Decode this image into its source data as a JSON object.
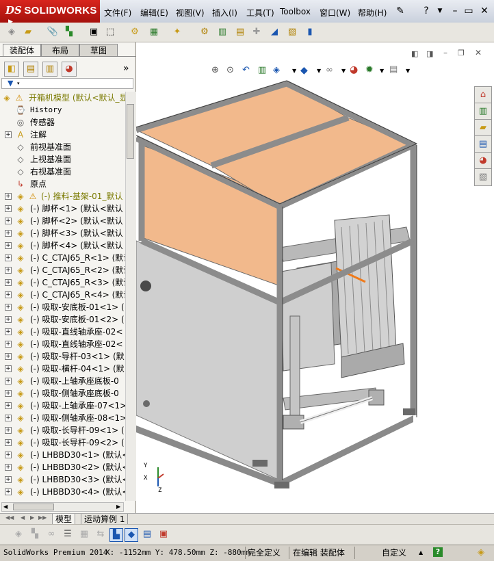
{
  "app": {
    "logo_ds": "DS",
    "logo_name": "SOLIDWORKS"
  },
  "menu": [
    "文件(F)",
    "编辑(E)",
    "视图(V)",
    "插入(I)",
    "工具(T)",
    "Toolbox",
    "窗口(W)",
    "帮助(H)"
  ],
  "left_tabs": [
    "装配体",
    "布局",
    "草图"
  ],
  "tree": {
    "root": "开箱机模型  (默认<默认_显",
    "items": [
      {
        "label": "History",
        "mono": true
      },
      {
        "label": "传感器"
      },
      {
        "label": "注解",
        "expand": true
      },
      {
        "label": "前视基准面"
      },
      {
        "label": "上视基准面"
      },
      {
        "label": "右视基准面"
      },
      {
        "label": "原点"
      }
    ],
    "components": [
      {
        "label": "(-) 推料-基架-01_默认",
        "warn": true,
        "color": "#7a7a00"
      },
      {
        "label": "(-) 脚杯<1> (默认<默认"
      },
      {
        "label": "(-) 脚杯<2> (默认<默认"
      },
      {
        "label": "(-) 脚杯<3> (默认<默认"
      },
      {
        "label": "(-) 脚杯<4> (默认<默认"
      },
      {
        "label": "(-) C_CTAJ65_R<1> (默认"
      },
      {
        "label": "(-) C_CTAJ65_R<2> (默认"
      },
      {
        "label": "(-) C_CTAJ65_R<3> (默认"
      },
      {
        "label": "(-) C_CTAJ65_R<4> (默认"
      },
      {
        "label": "(-) 吸取-安底板-01<1> ("
      },
      {
        "label": "(-) 吸取-安底板-01<2> ("
      },
      {
        "label": "(-) 吸取-直线轴承座-02<"
      },
      {
        "label": "(-) 吸取-直线轴承座-02<"
      },
      {
        "label": "(-) 吸取-导杆-03<1> (默"
      },
      {
        "label": "(-) 吸取-横杆-04<1> (默"
      },
      {
        "label": "(-) 吸取-上轴承座底板-0"
      },
      {
        "label": "(-) 吸取-侧轴承座底板-0"
      },
      {
        "label": "(-) 吸取-上轴承座-07<1>"
      },
      {
        "label": "(-) 吸取-侧轴承座-08<1>"
      },
      {
        "label": "(-) 吸取-长导杆-09<1> ("
      },
      {
        "label": "(-) 吸取-长导杆-09<2> ("
      },
      {
        "label": "(-) LHBBD30<1> (默认<默"
      },
      {
        "label": "(-) LHBBD30<2> (默认<默"
      },
      {
        "label": "(-) LHBBD30<3> (默认<默"
      },
      {
        "label": "(-) LHBBD30<4> (默认<默"
      }
    ]
  },
  "bottom_tabs": [
    "模型",
    "运动算例 1"
  ],
  "triad": {
    "x": "X",
    "y": "Y",
    "z": "Z"
  },
  "status": {
    "product": "SolidWorks Premium 2014",
    "coords": "X: -1152mm Y: 478.50mm Z: -880mm",
    "constraint": "完全定义",
    "mode": "在编辑 装配体",
    "custom": "自定义"
  },
  "colors": {
    "brand": "#c8161d",
    "panel_orange": "#f2b98c",
    "frame_gray": "#9c9c9c",
    "sheet": "#cfcfcf"
  }
}
